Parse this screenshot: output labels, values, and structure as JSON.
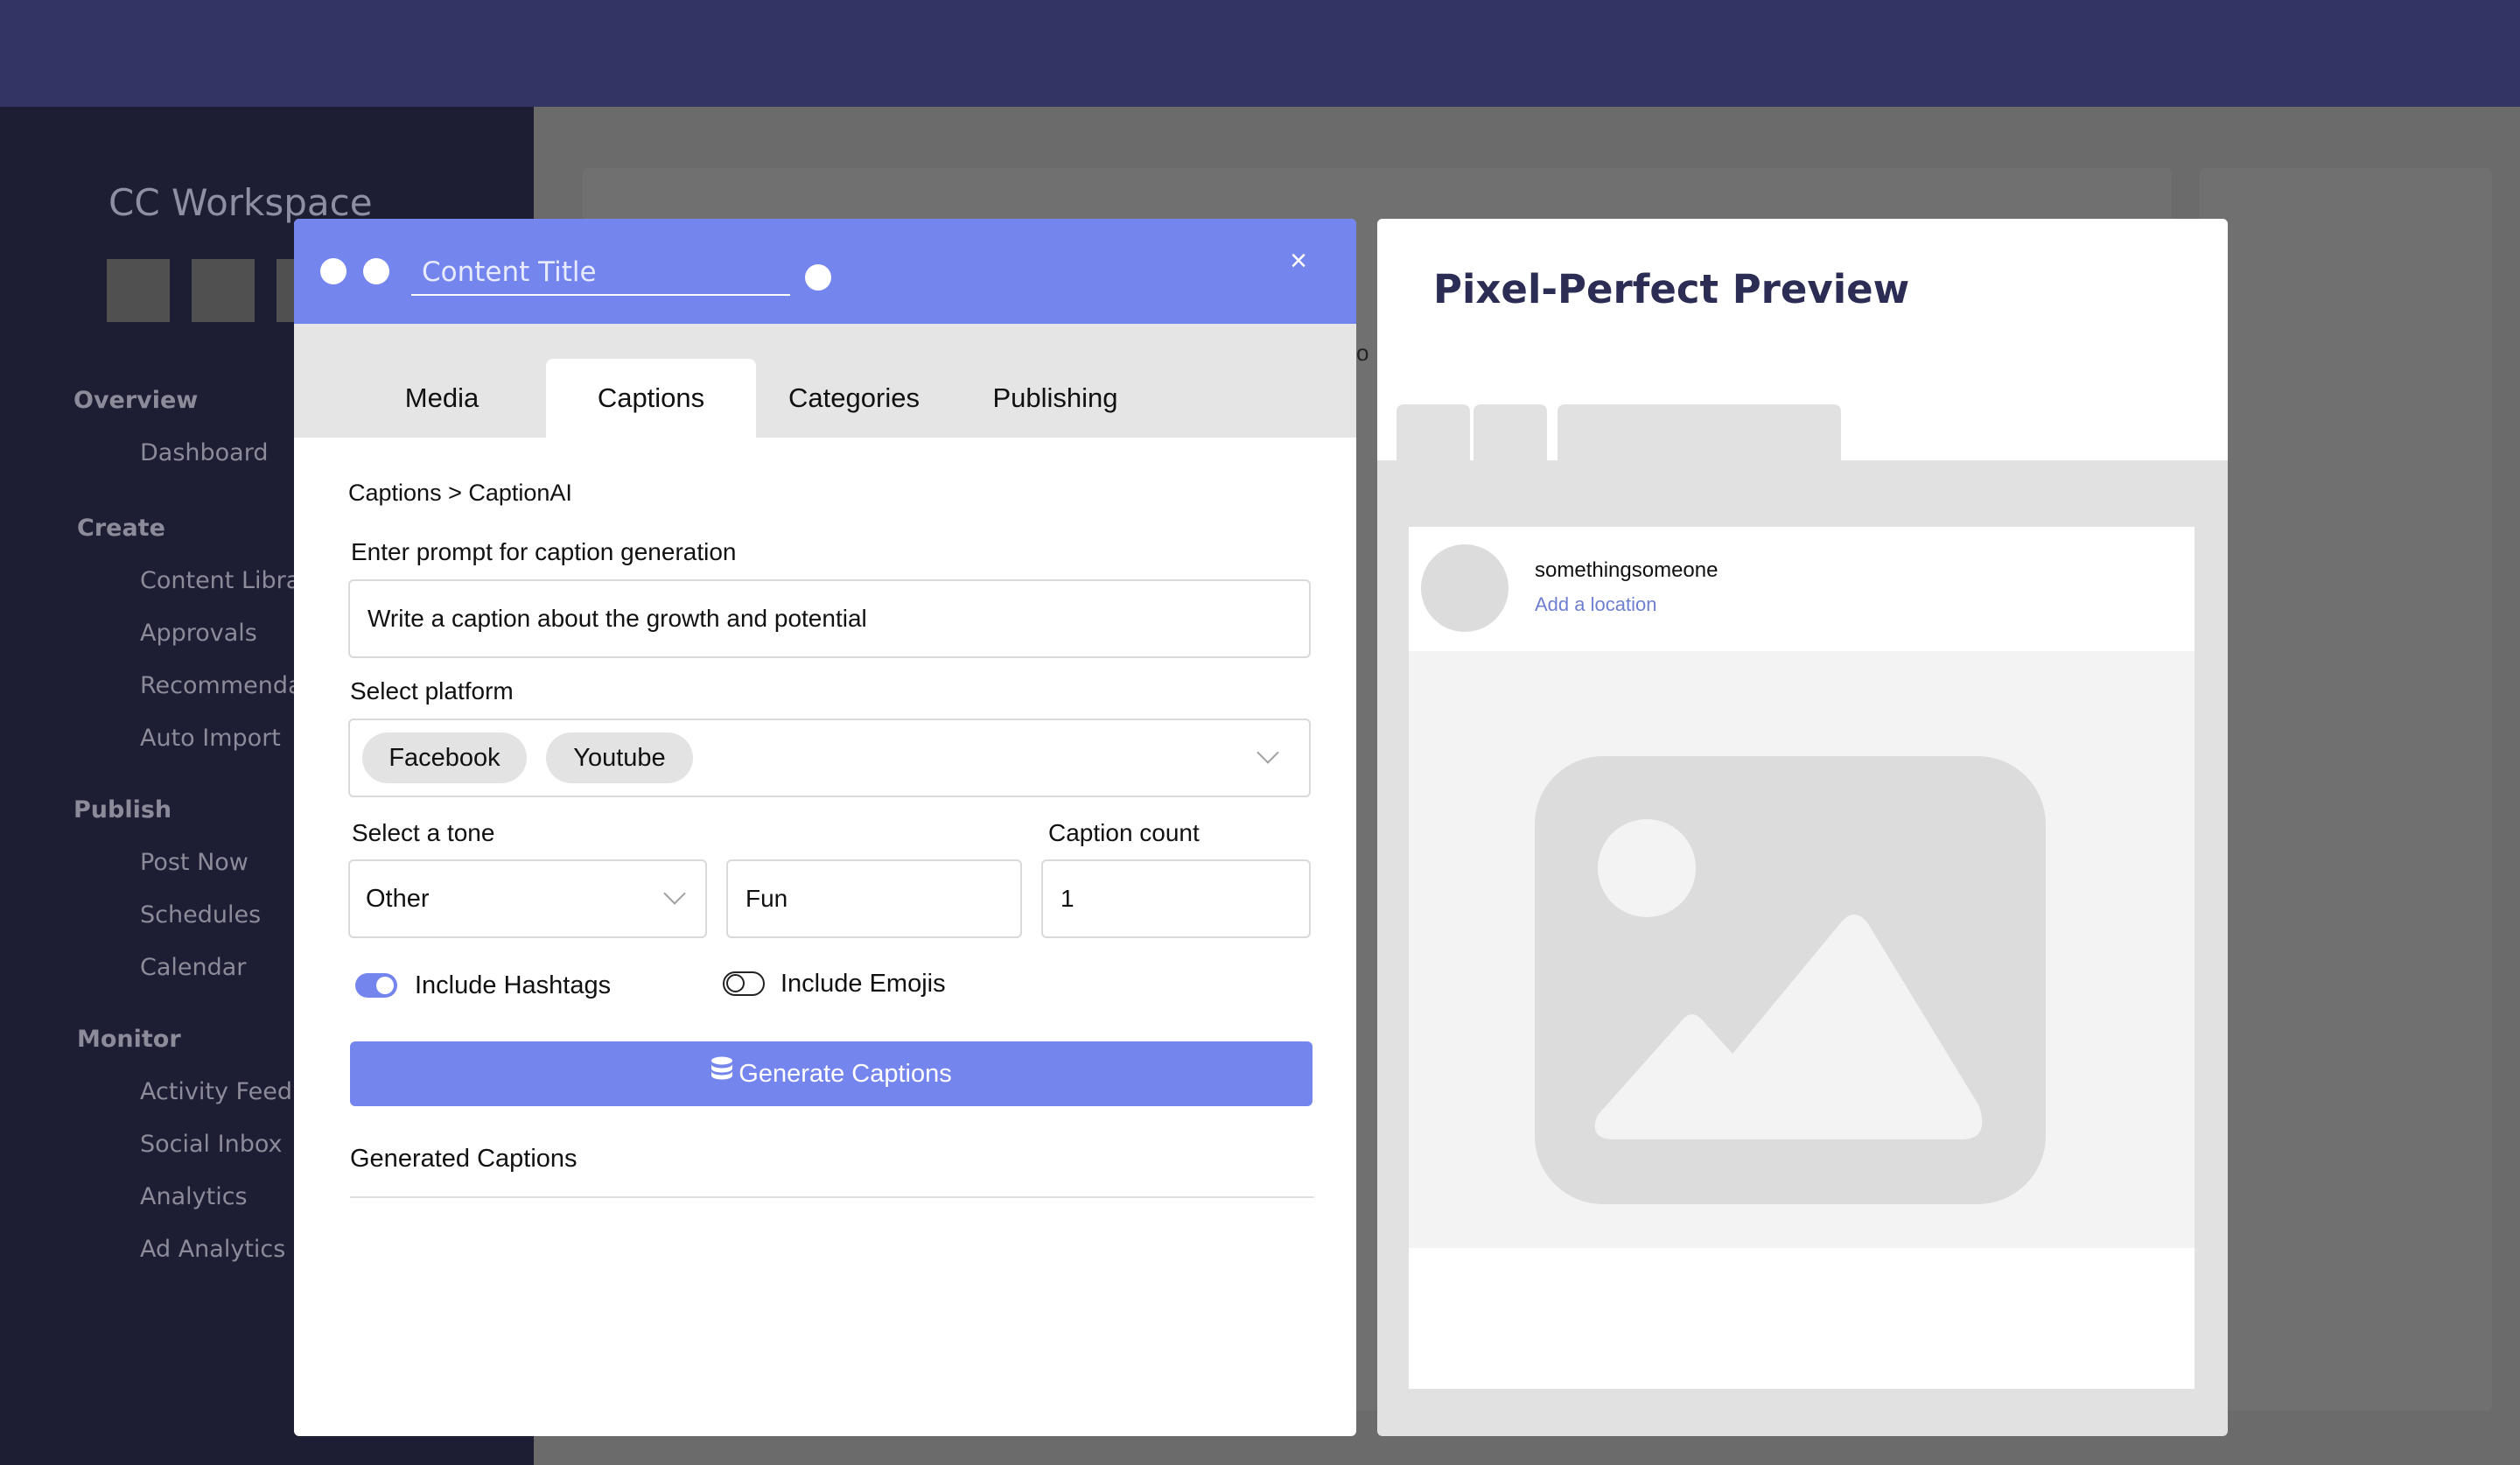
{
  "background": {
    "workspace_title": "CC Workspace",
    "nav": [
      {
        "header": "Overview",
        "items": [
          "Dashboard"
        ]
      },
      {
        "header": "Create",
        "items": [
          "Content Libra",
          "Approvals",
          "Recommenda",
          "Auto Import"
        ]
      },
      {
        "header": "Publish",
        "items": [
          "Post Now",
          "Schedules",
          "Calendar"
        ]
      },
      {
        "header": "Monitor",
        "items": [
          "Activity Feed",
          "Social Inbox",
          "Analytics",
          "Ad Analytics"
        ]
      }
    ],
    "stray_text": "o"
  },
  "modal": {
    "title_placeholder": "Content Title",
    "close_symbol": "×",
    "tabs": [
      {
        "label": "Media",
        "active": false
      },
      {
        "label": "Captions",
        "active": true
      },
      {
        "label": "Categories",
        "active": false
      },
      {
        "label": "Publishing",
        "active": false
      }
    ],
    "breadcrumb": "Captions > CaptionAI",
    "prompt": {
      "label": "Enter prompt for caption generation",
      "value": "Write a caption about the growth and potential"
    },
    "platform": {
      "label": "Select platform",
      "chips": [
        "Facebook",
        "Youtube"
      ]
    },
    "tone": {
      "label": "Select a tone",
      "selected": "Other",
      "custom_value": "Fun"
    },
    "caption_count": {
      "label": "Caption count",
      "value": "1"
    },
    "toggles": {
      "hashtags": {
        "label": "Include Hashtags",
        "on": true
      },
      "emojis": {
        "label": "Include Emojis",
        "on": false
      }
    },
    "generate_button": "Generate Captions",
    "generated_heading": "Generated Captions"
  },
  "preview": {
    "title": "Pixel-Perfect Preview",
    "username": "somethingsomeone",
    "location": "Add a location"
  },
  "colors": {
    "accent": "#7585ee",
    "topbar": "#323463",
    "sidebar": "#1d1d33",
    "preview_title": "#2c2d55"
  }
}
